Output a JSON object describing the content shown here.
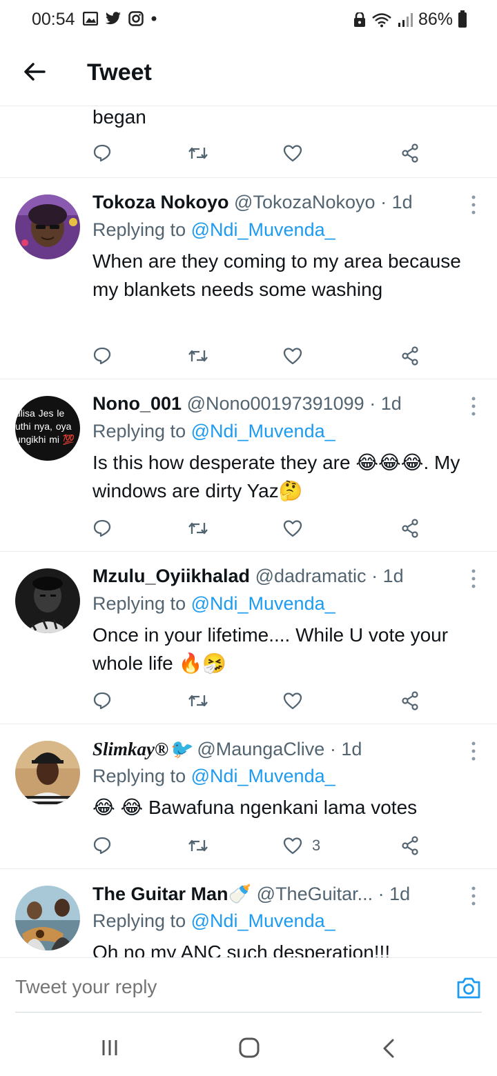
{
  "status_bar": {
    "time": "00:54",
    "battery": "86%",
    "icons_left": [
      "gallery-icon",
      "twitter-icon",
      "instagram-icon",
      "dot-icon"
    ],
    "icons_right": [
      "security-icon",
      "wifi-icon",
      "signal-icon",
      "battery-icon"
    ]
  },
  "header": {
    "title": "Tweet"
  },
  "partial_tweet": {
    "text": "began"
  },
  "tweets": [
    {
      "name": "Tokoza Nokoyo",
      "handle": "@TokozaNokoyo",
      "time": "· 1d",
      "replying_prefix": "Replying to ",
      "replying_to": "@Ndi_Muvenda_",
      "text": "When are they coming to my area because my blankets needs some washing",
      "likes": ""
    },
    {
      "name": "Nono_001",
      "handle": "@Nono00197391099",
      "time": "· 1d",
      "replying_prefix": "Replying to ",
      "replying_to": "@Ndi_Muvenda_",
      "text": "Is this how desperate they are 😂😂😂. My windows are dirty Yaz🤔",
      "likes": ""
    },
    {
      "name": "Mzulu_Oyiikhalad",
      "handle": "@dadramatic",
      "time": "· 1d",
      "replying_prefix": "Replying to ",
      "replying_to": "@Ndi_Muvenda_",
      "text": "Once in your lifetime.... While U vote your whole life 🔥🤧",
      "likes": ""
    },
    {
      "name": "Slimkay®🐦",
      "handle": "@MaungaClive",
      "time": "· 1d",
      "replying_prefix": "Replying to ",
      "replying_to": "@Ndi_Muvenda_",
      "text": "😂 😂 Bawafuna ngenkani lama votes",
      "likes": "3"
    },
    {
      "name": "The Guitar Man🍼",
      "handle": "@TheGuitar...",
      "time": "· 1d",
      "replying_prefix": "Replying to ",
      "replying_to": "@Ndi_Muvenda_",
      "text": "Oh no my ANC such desperation!!!",
      "likes": ""
    }
  ],
  "reply_bar": {
    "placeholder": "Tweet your reply"
  },
  "avatar_text": {
    "nono": "ulisa Jes le uthi nya, oya ungikhi mi 💯"
  },
  "colors": {
    "accent": "#1d9bf0",
    "muted": "#536471",
    "divider": "#e6ecf0"
  }
}
